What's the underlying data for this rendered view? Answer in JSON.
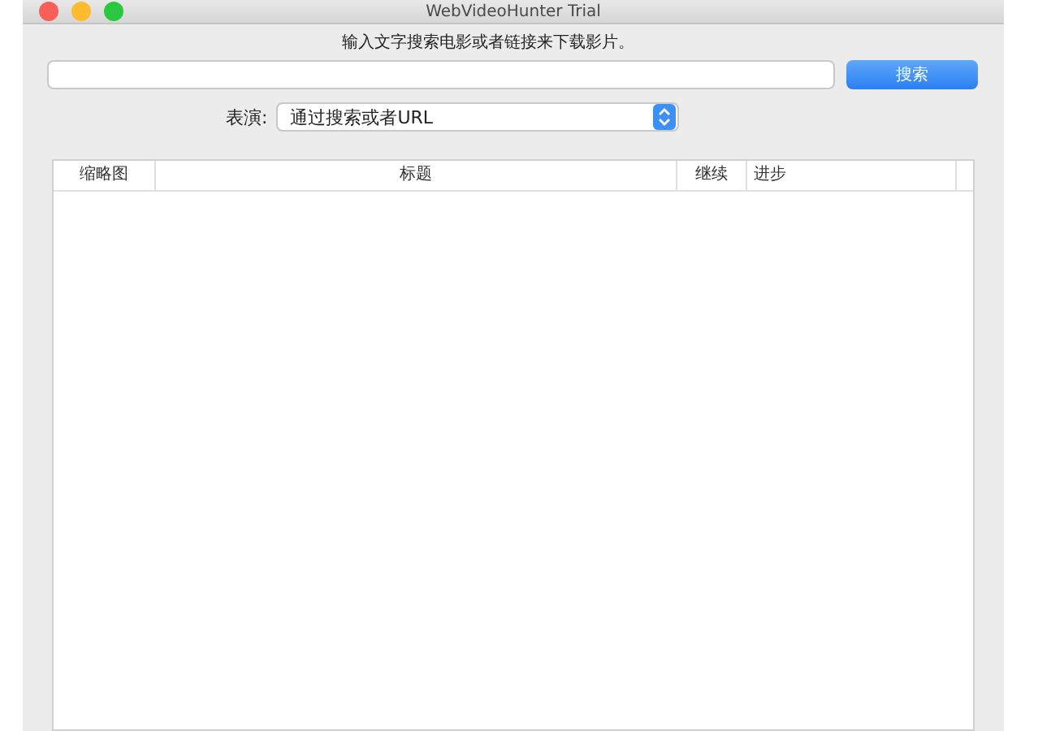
{
  "window": {
    "title": "WebVideoHunter Trial"
  },
  "instruction": "输入文字搜索电影或者链接来下载影片。",
  "search": {
    "button": "搜索"
  },
  "mode": {
    "label": "表演:",
    "value": "通过搜索或者URL"
  },
  "table": {
    "columns": [
      {
        "label": "缩略图"
      },
      {
        "label": "标题"
      },
      {
        "label": "继续"
      },
      {
        "label": "进步"
      }
    ]
  }
}
